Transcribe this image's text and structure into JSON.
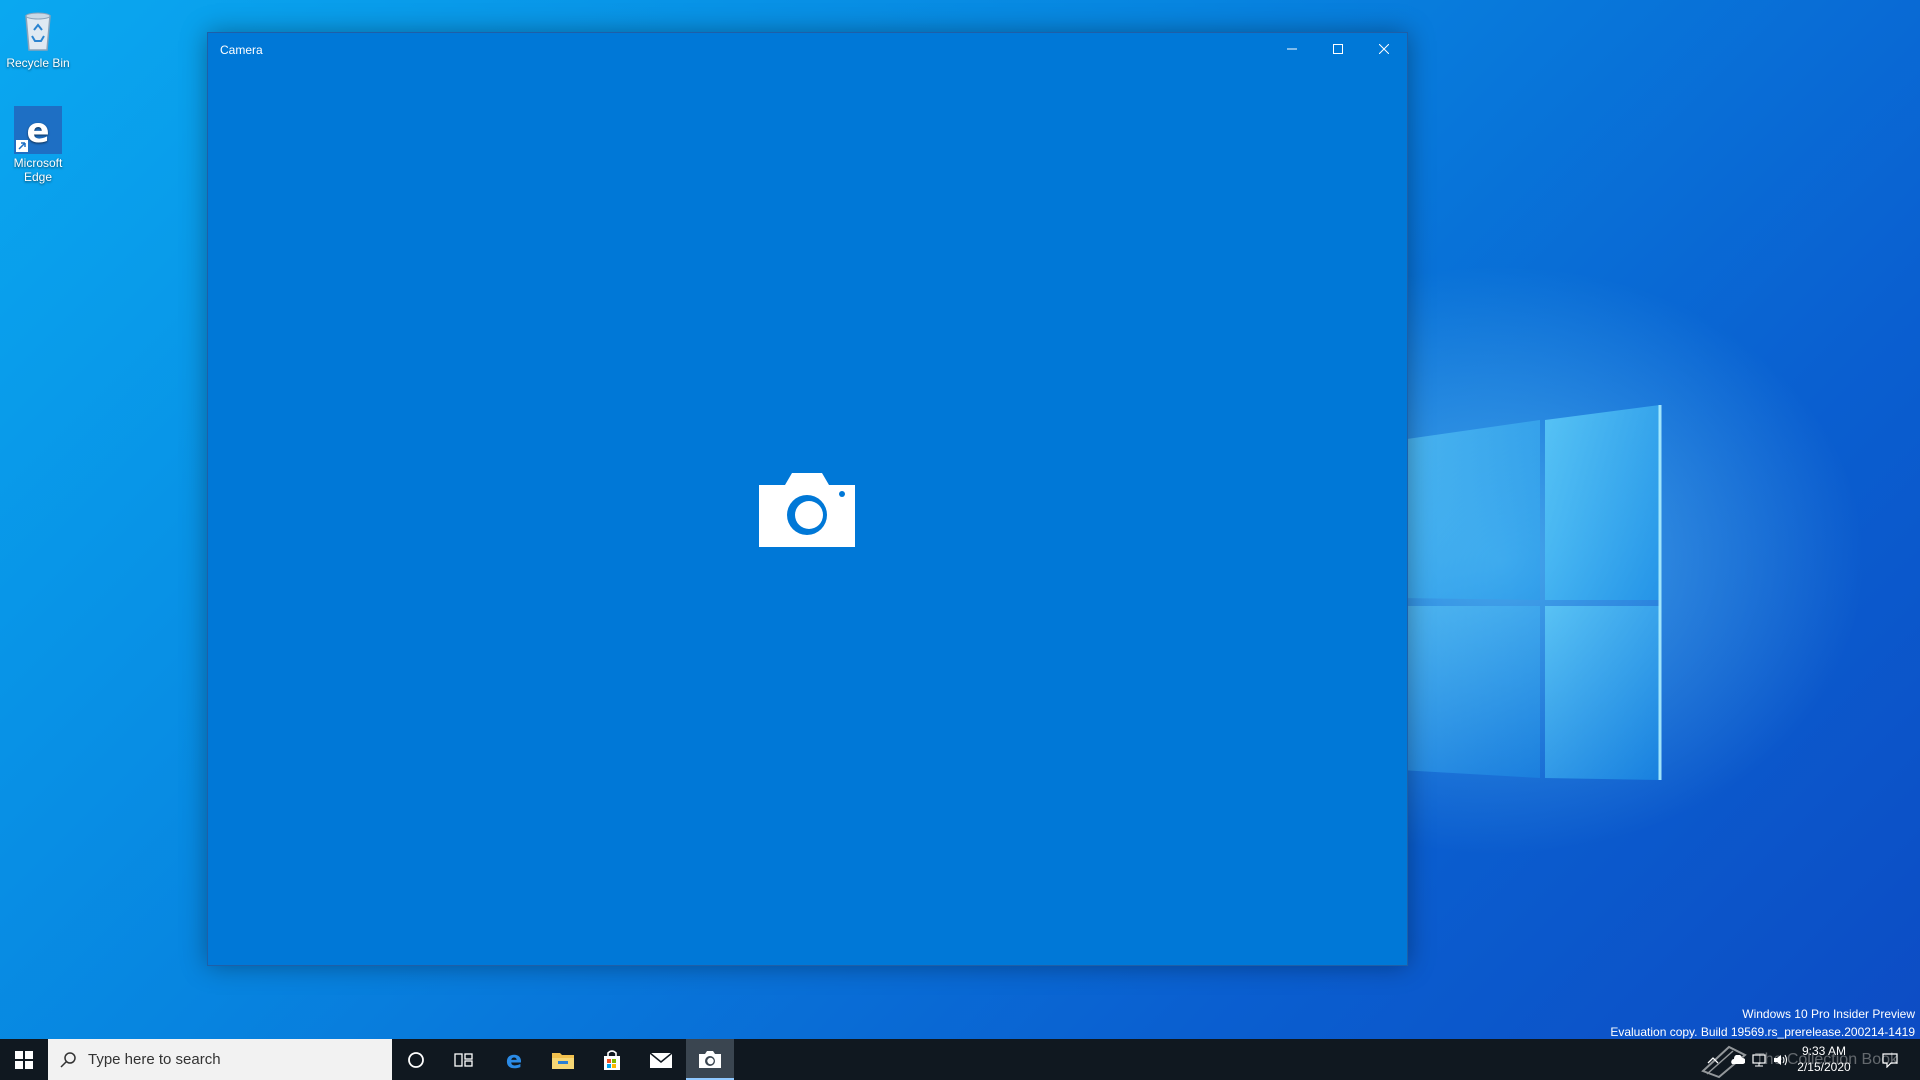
{
  "desktop": {
    "icons": [
      {
        "label": "Recycle Bin",
        "icon": "recycle-bin-icon"
      },
      {
        "label": "Microsoft Edge",
        "icon": "edge-icon"
      }
    ]
  },
  "window": {
    "title": "Camera",
    "controls": [
      "minimize-icon",
      "maximize-icon",
      "close-icon"
    ],
    "background": "#0078d7",
    "center_icon": "camera-icon"
  },
  "watermark": {
    "line1": "Windows 10 Pro Insider Preview",
    "line2": "Evaluation copy. Build 19569.rs_prerelease.200214-1419",
    "overlay": "The Collection Book"
  },
  "taskbar": {
    "search_placeholder": "Type here to search",
    "apps": [
      "cortana-icon",
      "task-view-icon",
      "edge-icon",
      "file-explorer-icon",
      "store-icon",
      "mail-icon",
      "camera-icon"
    ],
    "active_app": "camera-icon",
    "time": "9:33 AM",
    "date": "2/15/2020"
  },
  "colors": {
    "accent": "#0078d7",
    "taskbar": "#101820"
  }
}
